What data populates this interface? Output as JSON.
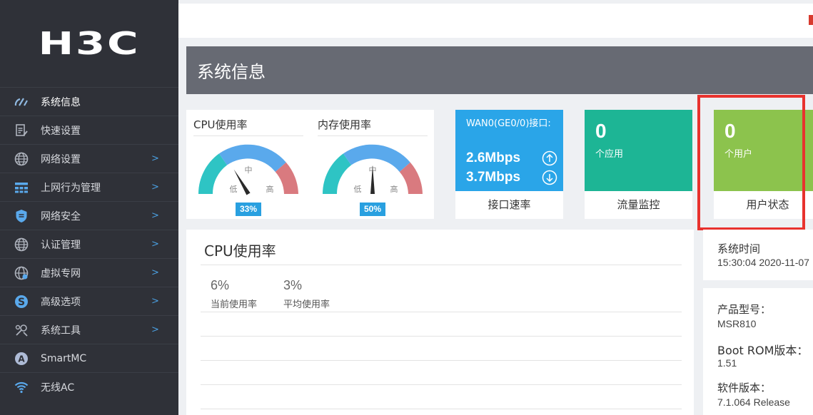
{
  "logo": "H3C",
  "sidebar": {
    "items": [
      {
        "label": "系统信息",
        "icon": "gauge-icon",
        "active": true,
        "has_arrow": false
      },
      {
        "label": "快速设置",
        "icon": "quick-setup-icon",
        "active": false,
        "has_arrow": false
      },
      {
        "label": "网络设置",
        "icon": "globe-icon",
        "active": false,
        "has_arrow": true
      },
      {
        "label": "上网行为管理",
        "icon": "behavior-icon",
        "active": false,
        "has_arrow": true
      },
      {
        "label": "网络安全",
        "icon": "shield-icon",
        "active": false,
        "has_arrow": true
      },
      {
        "label": "认证管理",
        "icon": "globe-icon",
        "active": false,
        "has_arrow": true
      },
      {
        "label": "虚拟专网",
        "icon": "vpn-globe-icon",
        "active": false,
        "has_arrow": true
      },
      {
        "label": "高级选项",
        "icon": "advanced-s-icon",
        "active": false,
        "has_arrow": true
      },
      {
        "label": "系统工具",
        "icon": "tools-icon",
        "active": false,
        "has_arrow": true
      },
      {
        "label": "SmartMC",
        "icon": "smartmc-icon",
        "active": false,
        "has_arrow": false
      },
      {
        "label": "无线AC",
        "icon": "wifi-icon",
        "active": false,
        "has_arrow": false
      }
    ],
    "arrow": ">"
  },
  "page": {
    "title": "系统信息"
  },
  "gauges": [
    {
      "title": "CPU使用率",
      "value": 33,
      "badge": "33%",
      "low": "低",
      "mid": "中",
      "high": "高"
    },
    {
      "title": "内存使用率",
      "value": 50,
      "badge": "50%",
      "low": "低",
      "mid": "中",
      "high": "高"
    }
  ],
  "tiles": {
    "wan": {
      "title": "WAN0(GE0/0)接口:",
      "up_rate": "2.6Mbps",
      "down_rate": "3.7Mbps",
      "footer": "接口速率",
      "color": "#2aa5e8"
    },
    "apps": {
      "count": "0",
      "sub": "个应用",
      "footer": "流量监控",
      "color": "#1db595"
    },
    "users": {
      "count": "0",
      "sub": "个用户",
      "footer": "用户状态",
      "color": "#8cc34d"
    }
  },
  "cpu_panel": {
    "title": "CPU使用率",
    "current_value": "6%",
    "current_label": "当前使用率",
    "average_value": "3%",
    "average_label": "平均使用率"
  },
  "system_time": {
    "label": "系统时间",
    "value": "15:30:04  2020-11-07"
  },
  "product": {
    "model_label": "产品型号：",
    "model_value": "MSR810",
    "bootrom_label": "Boot ROM版本：",
    "bootrom_value": "1.51",
    "software_label": "软件版本：",
    "software_value": "7.1.064 Release"
  },
  "colors": {
    "sidebar_bg": "#2f3138",
    "accent": "#29a0e0",
    "highlight": "#e8322e"
  }
}
